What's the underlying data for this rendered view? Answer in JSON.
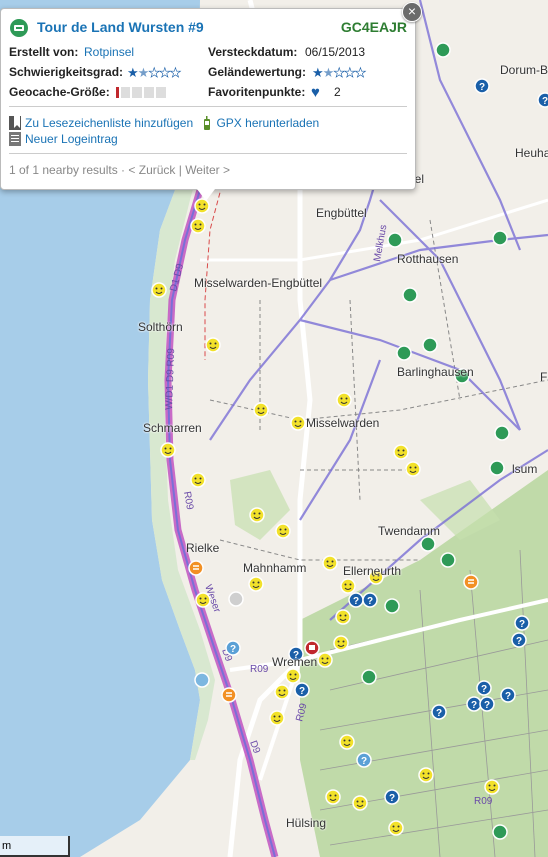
{
  "popup": {
    "title": "Tour de Land Wursten #9",
    "code": "GC4EAJR",
    "created_by_label": "Erstellt von:",
    "created_by_value": "Rotpinsel",
    "hidden_label": "Versteckdatum:",
    "hidden_value": "06/15/2013",
    "difficulty_label": "Schwierigkeitsgrad:",
    "difficulty_value": 1.5,
    "terrain_label": "Geländewertung:",
    "terrain_value": 1.5,
    "size_label": "Geocache-Größe:",
    "size_value": "micro",
    "favorites_label": "Favoritenpunkte:",
    "favorites_value": "2",
    "action_bookmark": "Zu Lesezeichenliste hinzufügen",
    "action_gpx": "GPX herunterladen",
    "action_log": "Neuer Logeintrag",
    "nav_text": "1 of 1 nearby results · < Zurück | Weiter >",
    "close_symbol": "×"
  },
  "map": {
    "places": [
      {
        "id": "dorum",
        "label": "Dorum-Blie"
      },
      {
        "id": "heuha",
        "label": "Heuha"
      },
      {
        "id": "ttel",
        "label": "ttel"
      },
      {
        "id": "engbuttel",
        "label": "Engbüttel"
      },
      {
        "id": "rotthausen",
        "label": "Rotthausen"
      },
      {
        "id": "misselwarden-engbuttel",
        "label": "Misselwarden-Engbüttel"
      },
      {
        "id": "solthorn",
        "label": "Solthörn"
      },
      {
        "id": "barlinghausen",
        "label": "Barlinghausen"
      },
      {
        "id": "f",
        "label": "F"
      },
      {
        "id": "schmarren",
        "label": "Schmarren"
      },
      {
        "id": "misselwarden",
        "label": "Misselwarden"
      },
      {
        "id": "lsum",
        "label": "lsum"
      },
      {
        "id": "twendamm",
        "label": "Twendamm"
      },
      {
        "id": "rielke",
        "label": "Rielke"
      },
      {
        "id": "mahnhamm",
        "label": "Mahnhamm"
      },
      {
        "id": "ellerneurth",
        "label": "Ellerneurth"
      },
      {
        "id": "wremen",
        "label": "Wremen"
      },
      {
        "id": "hulsing",
        "label": "Hülsing"
      }
    ],
    "road_labels": {
      "d1d9": "D1 D9",
      "wd1": "W/D1 D9 R09",
      "r09a": "R09",
      "r09b": "R09",
      "r09c": "R09",
      "r09d": "R09",
      "melkhus": "Melkhus",
      "weser": "Weser",
      "d9": "D9",
      "d9b": "D9"
    },
    "scale_label": "m",
    "colors": {
      "sea": "#a7cde9",
      "land": "#f2efe9",
      "forest": "#b7d69e",
      "dike": "#c154c1",
      "cycle": "#7a6fd6",
      "traditional": "#2e9a57",
      "mystery": "#1a5fa8",
      "found": "#f2e12a",
      "multi": "#f29024"
    }
  }
}
